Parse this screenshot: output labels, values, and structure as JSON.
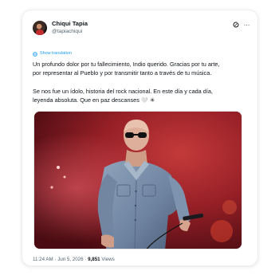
{
  "tweet": {
    "display_name": "Chiqui Tapia",
    "handle": "@tapiachiqui",
    "translate_label": "Show translation",
    "paragraph1": [
      "Un profundo dolor por tu fallecimiento, Indio querido. Gracias por tu arte,",
      "por representar al Pueblo y por transmitir tanto a través de tu música."
    ],
    "paragraph2": [
      "Se nos fue un ídolo, historia del rock nacional. En este día y cada día,",
      "leyenda absoluta. Que en paz descanses 🤍 ✳"
    ],
    "time": "11:24 AM",
    "separator": "·",
    "date": "Jun 5, 2026",
    "views_count": "9,851",
    "views_label": "Views"
  },
  "icons": {
    "avatar": "avatar",
    "grok": "grok-icon",
    "more": "more-icon",
    "translate": "globe-icon",
    "more_glyph": "···"
  },
  "colors": {
    "link": "#1d9bf0",
    "secondary_text": "#536471",
    "primary_text": "#0f1419",
    "stage_red": "#a8232b"
  }
}
